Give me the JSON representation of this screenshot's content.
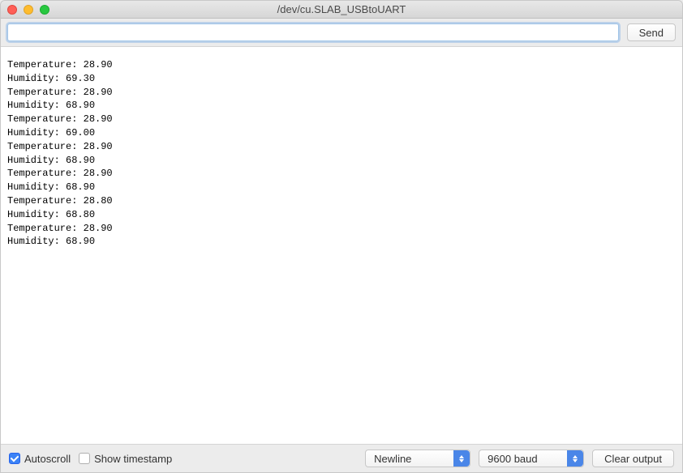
{
  "window": {
    "title": "/dev/cu.SLAB_USBtoUART"
  },
  "input_bar": {
    "input_value": "",
    "send_label": "Send"
  },
  "output_lines": [
    "Temperature: 28.90",
    "Humidity: 69.30",
    "Temperature: 28.90",
    "Humidity: 68.90",
    "Temperature: 28.90",
    "Humidity: 69.00",
    "Temperature: 28.90",
    "Humidity: 68.90",
    "Temperature: 28.90",
    "Humidity: 68.90",
    "Temperature: 28.80",
    "Humidity: 68.80",
    "Temperature: 28.90",
    "Humidity: 68.90"
  ],
  "bottom_bar": {
    "autoscroll_label": "Autoscroll",
    "autoscroll_checked": true,
    "timestamp_label": "Show timestamp",
    "timestamp_checked": false,
    "line_ending_selected": "Newline",
    "baud_selected": "9600 baud",
    "clear_label": "Clear output"
  }
}
